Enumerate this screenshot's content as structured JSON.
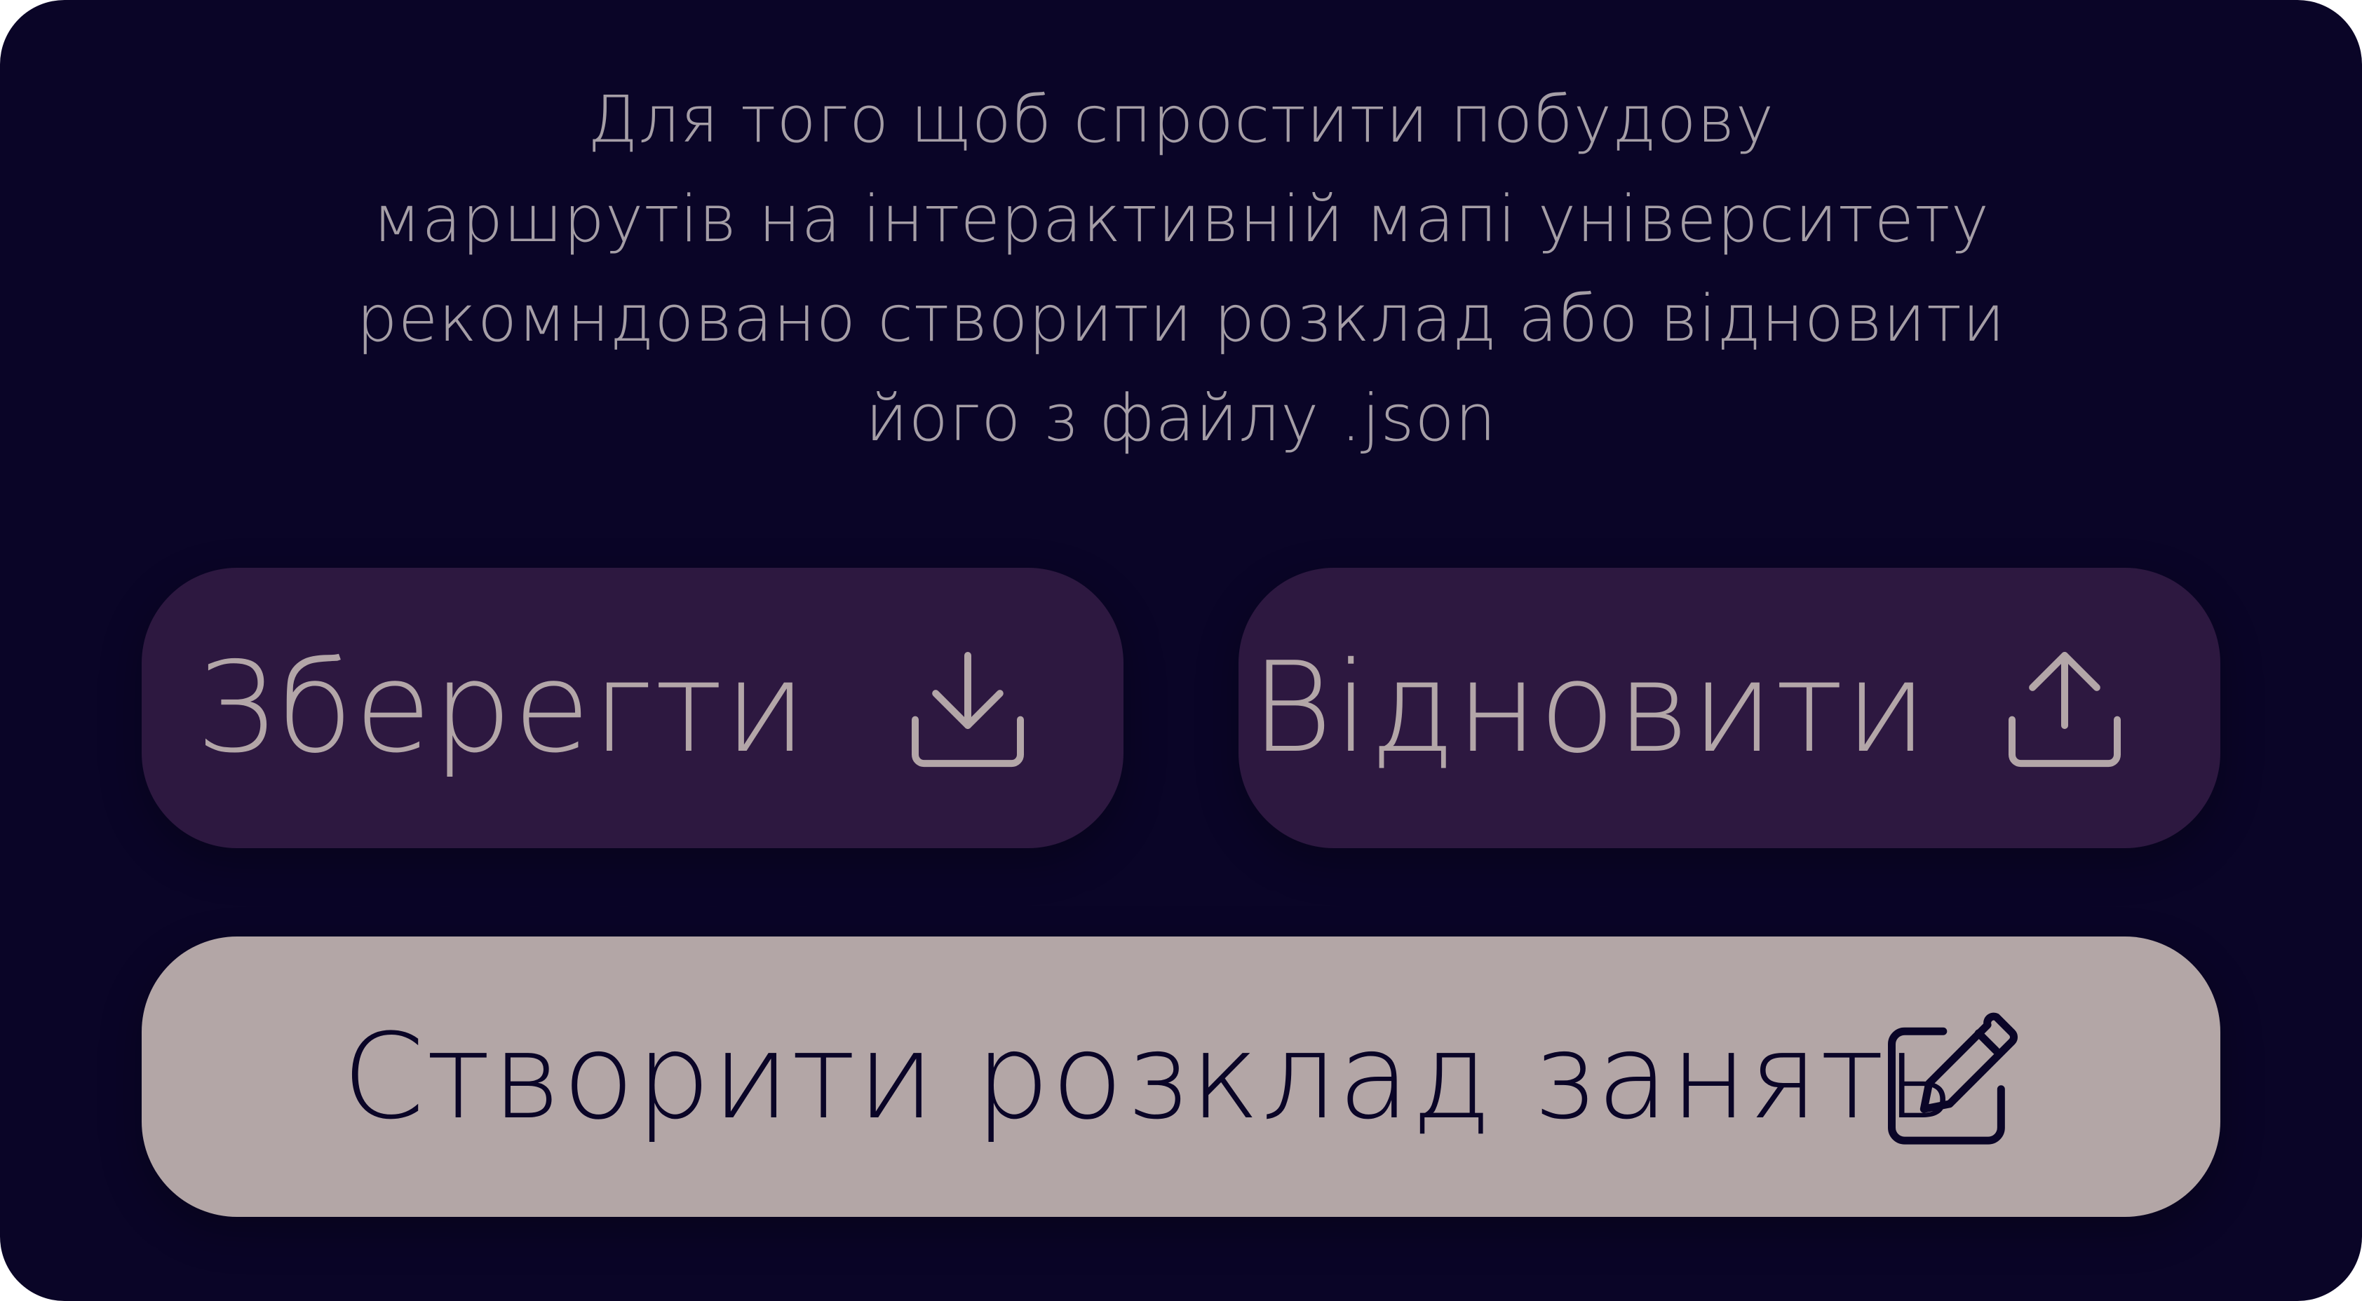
{
  "dialog": {
    "message_lines": [
      "Для того щоб спростити побудову",
      "маршрутів на інтерактивній мапі університету",
      "рекомндовано створити розклад або відновити",
      "його з файлу .json"
    ]
  },
  "buttons": {
    "save": {
      "label": "Зберегти",
      "icon": "download-icon"
    },
    "restore": {
      "label": "Відновити",
      "icon": "upload-icon"
    },
    "create": {
      "label": "Створити розклад занять",
      "icon": "edit-icon"
    }
  },
  "colors": {
    "background": "#0a0527",
    "secondary_button": "#2d1840",
    "secondary_text": "#b3a6a8",
    "primary_button": "#b3a6a6",
    "primary_text": "#0a0527",
    "message_text": "#a59ea6"
  }
}
